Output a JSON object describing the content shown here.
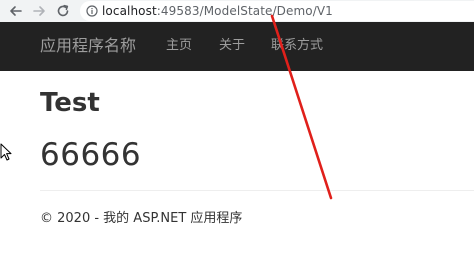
{
  "browser": {
    "url_host": "localhost",
    "url_rest": ":49583/ModelState/Demo/V1",
    "back_icon": "arrow-left-icon",
    "forward_icon": "arrow-right-icon",
    "reload_icon": "reload-icon",
    "info_icon": "info-icon"
  },
  "navbar": {
    "brand": "应用程序名称",
    "links": [
      "主页",
      "关于",
      "联系方式"
    ],
    "background": "#222222",
    "link_color": "#9d9d9d"
  },
  "content": {
    "heading": "Test",
    "value": "66666"
  },
  "footer": {
    "text": "© 2020 - 我的 ASP.NET 应用程序"
  },
  "annotation": {
    "color": "#e0201b"
  }
}
